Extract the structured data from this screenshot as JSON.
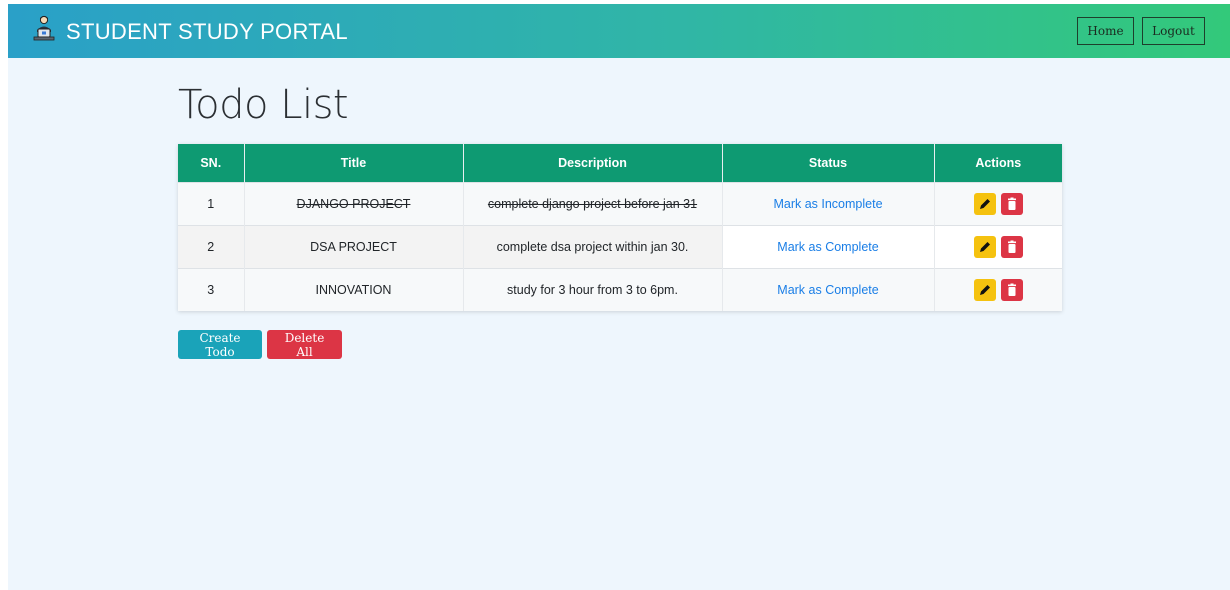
{
  "navbar": {
    "brand": "STUDENT STUDY PORTAL",
    "brand_icon": "student-laptop-icon",
    "home_label": "Home",
    "logout_label": "Logout"
  },
  "page_title": "Todo List",
  "table": {
    "headers": [
      "SN.",
      "Title",
      "Description",
      "Status",
      "Actions"
    ],
    "rows": [
      {
        "sn": "1",
        "title": "DJANGO PROJECT",
        "description": "complete django project before jan 31",
        "status": "Mark as Incomplete",
        "completed": true
      },
      {
        "sn": "2",
        "title": "DSA PROJECT",
        "description": "complete dsa project within jan 30.",
        "status": "Mark as Complete",
        "completed": false
      },
      {
        "sn": "3",
        "title": "INNOVATION",
        "description": "study for 3 hour from 3 to 6pm.",
        "status": "Mark as Complete",
        "completed": false
      }
    ],
    "action_icons": [
      "pencil-icon",
      "trash-icon"
    ]
  },
  "buttons": {
    "create": "Create Todo",
    "delete_all": "Delete All"
  },
  "colors": {
    "navbar_start": "#2aa0c8",
    "navbar_end": "#33c97a",
    "table_header": "#0e9a72",
    "link": "#1a7ee6",
    "edit": "#f5c20f",
    "danger": "#dc3545",
    "info": "#1aa3b9",
    "background": "#eef6fd"
  }
}
